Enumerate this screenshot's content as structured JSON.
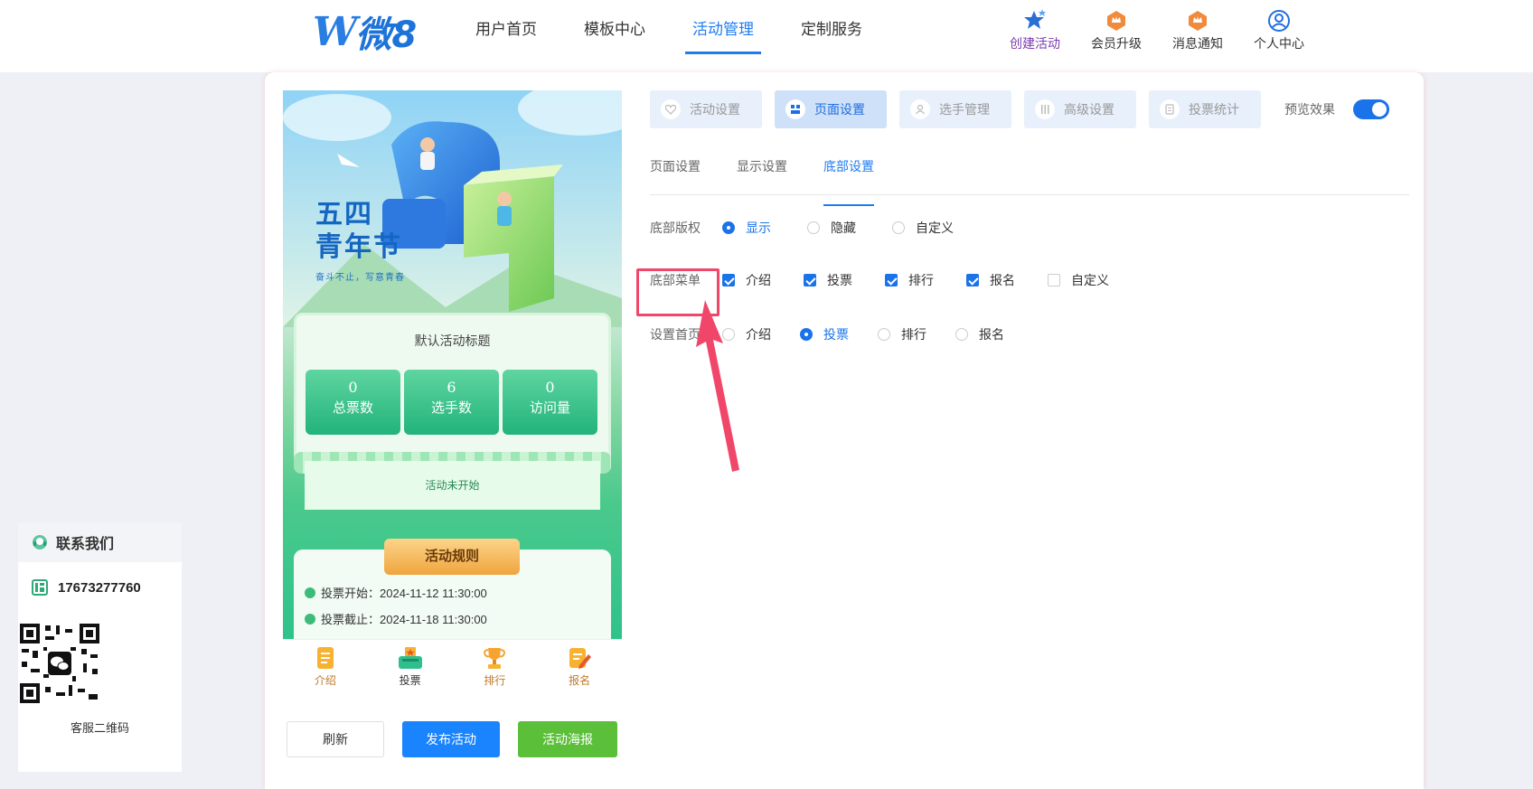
{
  "header": {
    "logo_w": "W",
    "logo_text": "微8",
    "nav": [
      "用户首页",
      "模板中心",
      "活动管理",
      "定制服务"
    ],
    "nav_active": 2,
    "tools": [
      {
        "label": "创建活动",
        "icon": "star-icon"
      },
      {
        "label": "会员升级",
        "icon": "crown-badge-icon"
      },
      {
        "label": "消息通知",
        "icon": "crown-badge-icon"
      },
      {
        "label": "个人中心",
        "icon": "user-icon"
      }
    ]
  },
  "contact": {
    "title": "联系我们",
    "phone": "17673277760",
    "qr_label": "客服二维码"
  },
  "preview": {
    "hero_title_line1": "五四",
    "hero_title_line2": "青年节",
    "hero_subtitle": "奋斗不止，写意青春",
    "activity_title": "默认活动标题",
    "stats": [
      {
        "value": "0",
        "label": "总票数"
      },
      {
        "value": "6",
        "label": "选手数"
      },
      {
        "value": "0",
        "label": "访问量"
      }
    ],
    "status": "活动未开始",
    "rules_title": "活动规则",
    "rules": [
      "投票开始：2024-11-12 11:30:00",
      "投票截止：2024-11-18 11:30:00"
    ],
    "tabbar": [
      {
        "label": "介绍",
        "icon": "doc-icon"
      },
      {
        "label": "投票",
        "icon": "ballot-box-icon"
      },
      {
        "label": "排行",
        "icon": "trophy-icon"
      },
      {
        "label": "报名",
        "icon": "signup-icon"
      }
    ],
    "tabbar_active": 1
  },
  "actions": {
    "refresh": "刷新",
    "publish": "发布活动",
    "poster": "活动海报"
  },
  "settings": {
    "segments": [
      "活动设置",
      "页面设置",
      "选手管理",
      "高级设置",
      "投票统计"
    ],
    "segment_active": 1,
    "preview_label": "预览效果",
    "preview_on": true,
    "subtabs": [
      "页面设置",
      "显示设置",
      "底部设置"
    ],
    "subtab_active": 2,
    "copyright": {
      "label": "底部版权",
      "options": [
        "显示",
        "隐藏",
        "自定义"
      ],
      "selected": 0
    },
    "menu": {
      "label": "底部菜单",
      "options": [
        "介绍",
        "投票",
        "排行",
        "报名",
        "自定义"
      ],
      "checked": [
        true,
        true,
        true,
        true,
        false
      ]
    },
    "home": {
      "label": "设置首页",
      "options": [
        "介绍",
        "投票",
        "排行",
        "报名"
      ],
      "selected": 1
    }
  },
  "colors": {
    "accent": "#1f7cf0",
    "highlight": "#f0466a",
    "publish": "#1a84ff",
    "poster": "#5bbf3a"
  }
}
